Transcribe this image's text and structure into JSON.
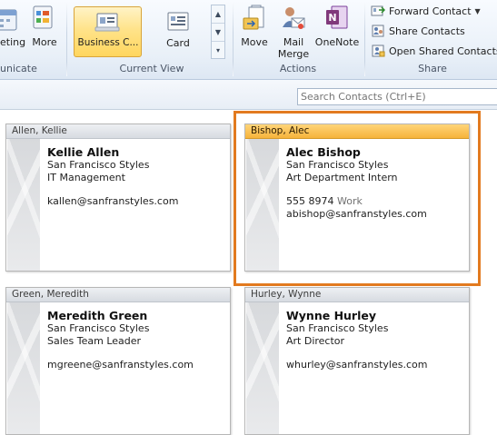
{
  "ribbon": {
    "meeting_label": "eting",
    "more_label": "More",
    "communicate_group": "unicate",
    "business_card_label": "Business C...",
    "card_label": "Card",
    "current_view_group": "Current View",
    "move_label": "Move",
    "mail_merge_label_1": "Mail",
    "mail_merge_label_2": "Merge",
    "onenote_label": "OneNote",
    "actions_group": "Actions",
    "forward_contact_label": "Forward Contact",
    "share_contacts_label": "Share Contacts",
    "open_shared_label": "Open Shared Contacts",
    "share_group": "Share"
  },
  "search": {
    "placeholder": "Search Contacts (Ctrl+E)"
  },
  "cards": [
    {
      "header": "Allen, Kellie",
      "name": "Kellie Allen",
      "company": "San Francisco Styles",
      "title": "IT Management",
      "phone": "",
      "phone_type": "",
      "email": "kallen@sanfranstyles.com"
    },
    {
      "header": "Bishop, Alec",
      "name": "Alec Bishop",
      "company": "San Francisco Styles",
      "title": "Art Department Intern",
      "phone": "555 8974",
      "phone_type": "Work",
      "email": "abishop@sanfranstyles.com"
    },
    {
      "header": "Green, Meredith",
      "name": "Meredith Green",
      "company": "San Francisco Styles",
      "title": "Sales Team Leader",
      "phone": "",
      "phone_type": "",
      "email": "mgreene@sanfranstyles.com"
    },
    {
      "header": "Hurley, Wynne",
      "name": "Wynne Hurley",
      "company": "San Francisco Styles",
      "title": "Art Director",
      "phone": "",
      "phone_type": "",
      "email": "whurley@sanfranstyles.com"
    }
  ],
  "colors": {
    "selected_header": "#f6b33b",
    "highlight_border": "#e27a1f"
  }
}
